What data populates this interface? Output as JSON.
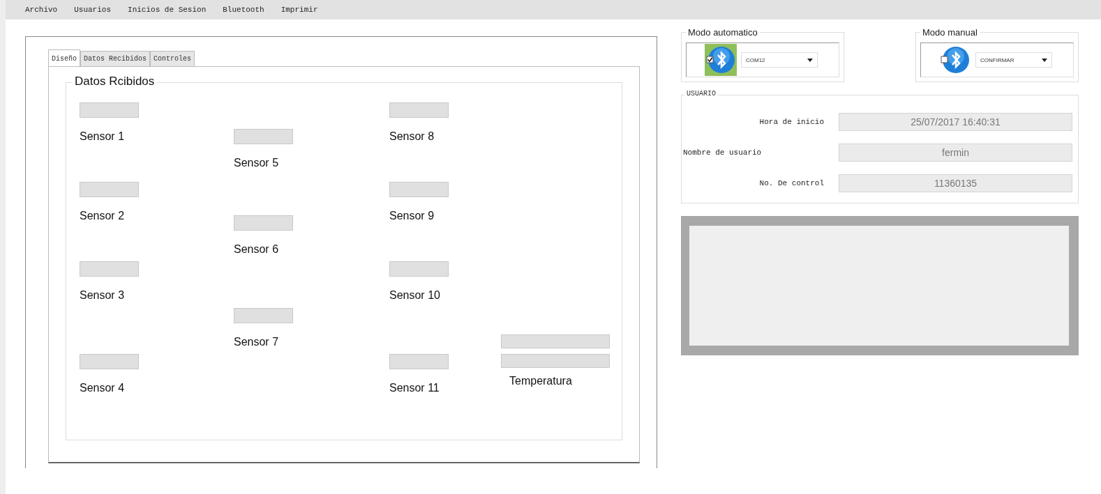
{
  "menu": [
    {
      "label": "Archivo"
    },
    {
      "label": "Usuarios"
    },
    {
      "label": "Inicios de Sesion"
    },
    {
      "label": "Bluetooth"
    },
    {
      "label": "Imprimir"
    }
  ],
  "tabs": [
    {
      "label": "Diseño",
      "selected": true
    },
    {
      "label": "Datos Recibidos",
      "selected": false
    },
    {
      "label": "Controles",
      "selected": false
    }
  ],
  "group_title": "Datos Rcibidos",
  "sensors": [
    {
      "label": "Sensor 1"
    },
    {
      "label": "Sensor 2"
    },
    {
      "label": "Sensor 3"
    },
    {
      "label": "Sensor 4"
    },
    {
      "label": "Sensor 5"
    },
    {
      "label": "Sensor 6"
    },
    {
      "label": "Sensor 7"
    },
    {
      "label": "Sensor 8"
    },
    {
      "label": "Sensor 9"
    },
    {
      "label": "Sensor 10"
    },
    {
      "label": "Sensor 11"
    },
    {
      "label": "Temperatura",
      "kind": "double"
    }
  ],
  "modes": [
    {
      "title": "Modo automatico",
      "checked": true,
      "value": "COM12"
    },
    {
      "title": "Modo manual",
      "checked": false,
      "value": "CONFIRMAR"
    }
  ],
  "user": {
    "title": "USUARIO",
    "fields": [
      {
        "label": "Hora de inicio",
        "value": "25/07/2017 16:40:31"
      },
      {
        "label": "Nombre de usuario",
        "value": "fermin"
      },
      {
        "label": "No. De control",
        "value": "11360135"
      }
    ]
  }
}
